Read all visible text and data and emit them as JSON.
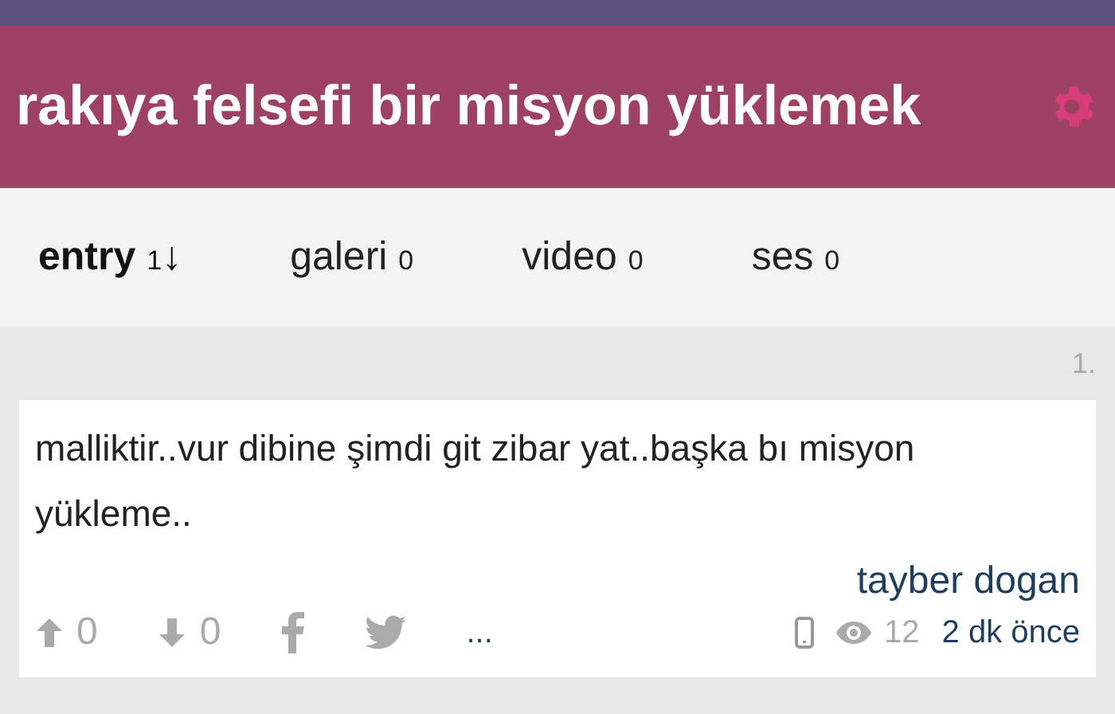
{
  "header": {
    "title": "rakıya felsefi bir misyon yüklemek"
  },
  "tabs": [
    {
      "label": "entry",
      "count": "1",
      "sort_arrow": "↓",
      "selected": true
    },
    {
      "label": "galeri",
      "count": "0",
      "selected": false
    },
    {
      "label": "video",
      "count": "0",
      "selected": false
    },
    {
      "label": "ses",
      "count": "0",
      "selected": false
    }
  ],
  "entry": {
    "number": "1.",
    "text": "malliktir..vur dibine şimdi git zibar yat..başka bı misyon yükleme..",
    "author": "tayber dogan",
    "upvotes": "0",
    "downvotes": "0",
    "more": "...",
    "views": "12",
    "time": "2 dk önce"
  }
}
